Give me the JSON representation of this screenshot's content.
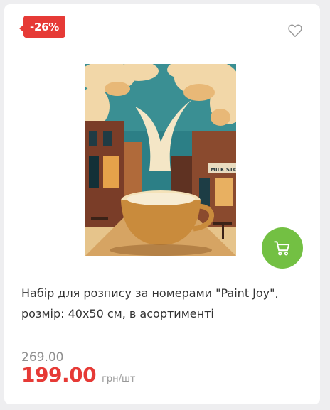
{
  "badge": {
    "discount": "-26%"
  },
  "product": {
    "title": "Набір для розпису за номерами \"Paint Joy\", розмір: 40х50 см, в асортименті",
    "image_sign_text": "MILK STORE"
  },
  "price": {
    "old": "269.00",
    "current": "199.00",
    "unit": "грн/шт"
  },
  "icons": {
    "wishlist": "heart-outline-icon",
    "cart": "shopping-cart-icon"
  },
  "colors": {
    "discount": "#e63a36",
    "cart_button": "#73c043",
    "price": "#e63a36"
  }
}
